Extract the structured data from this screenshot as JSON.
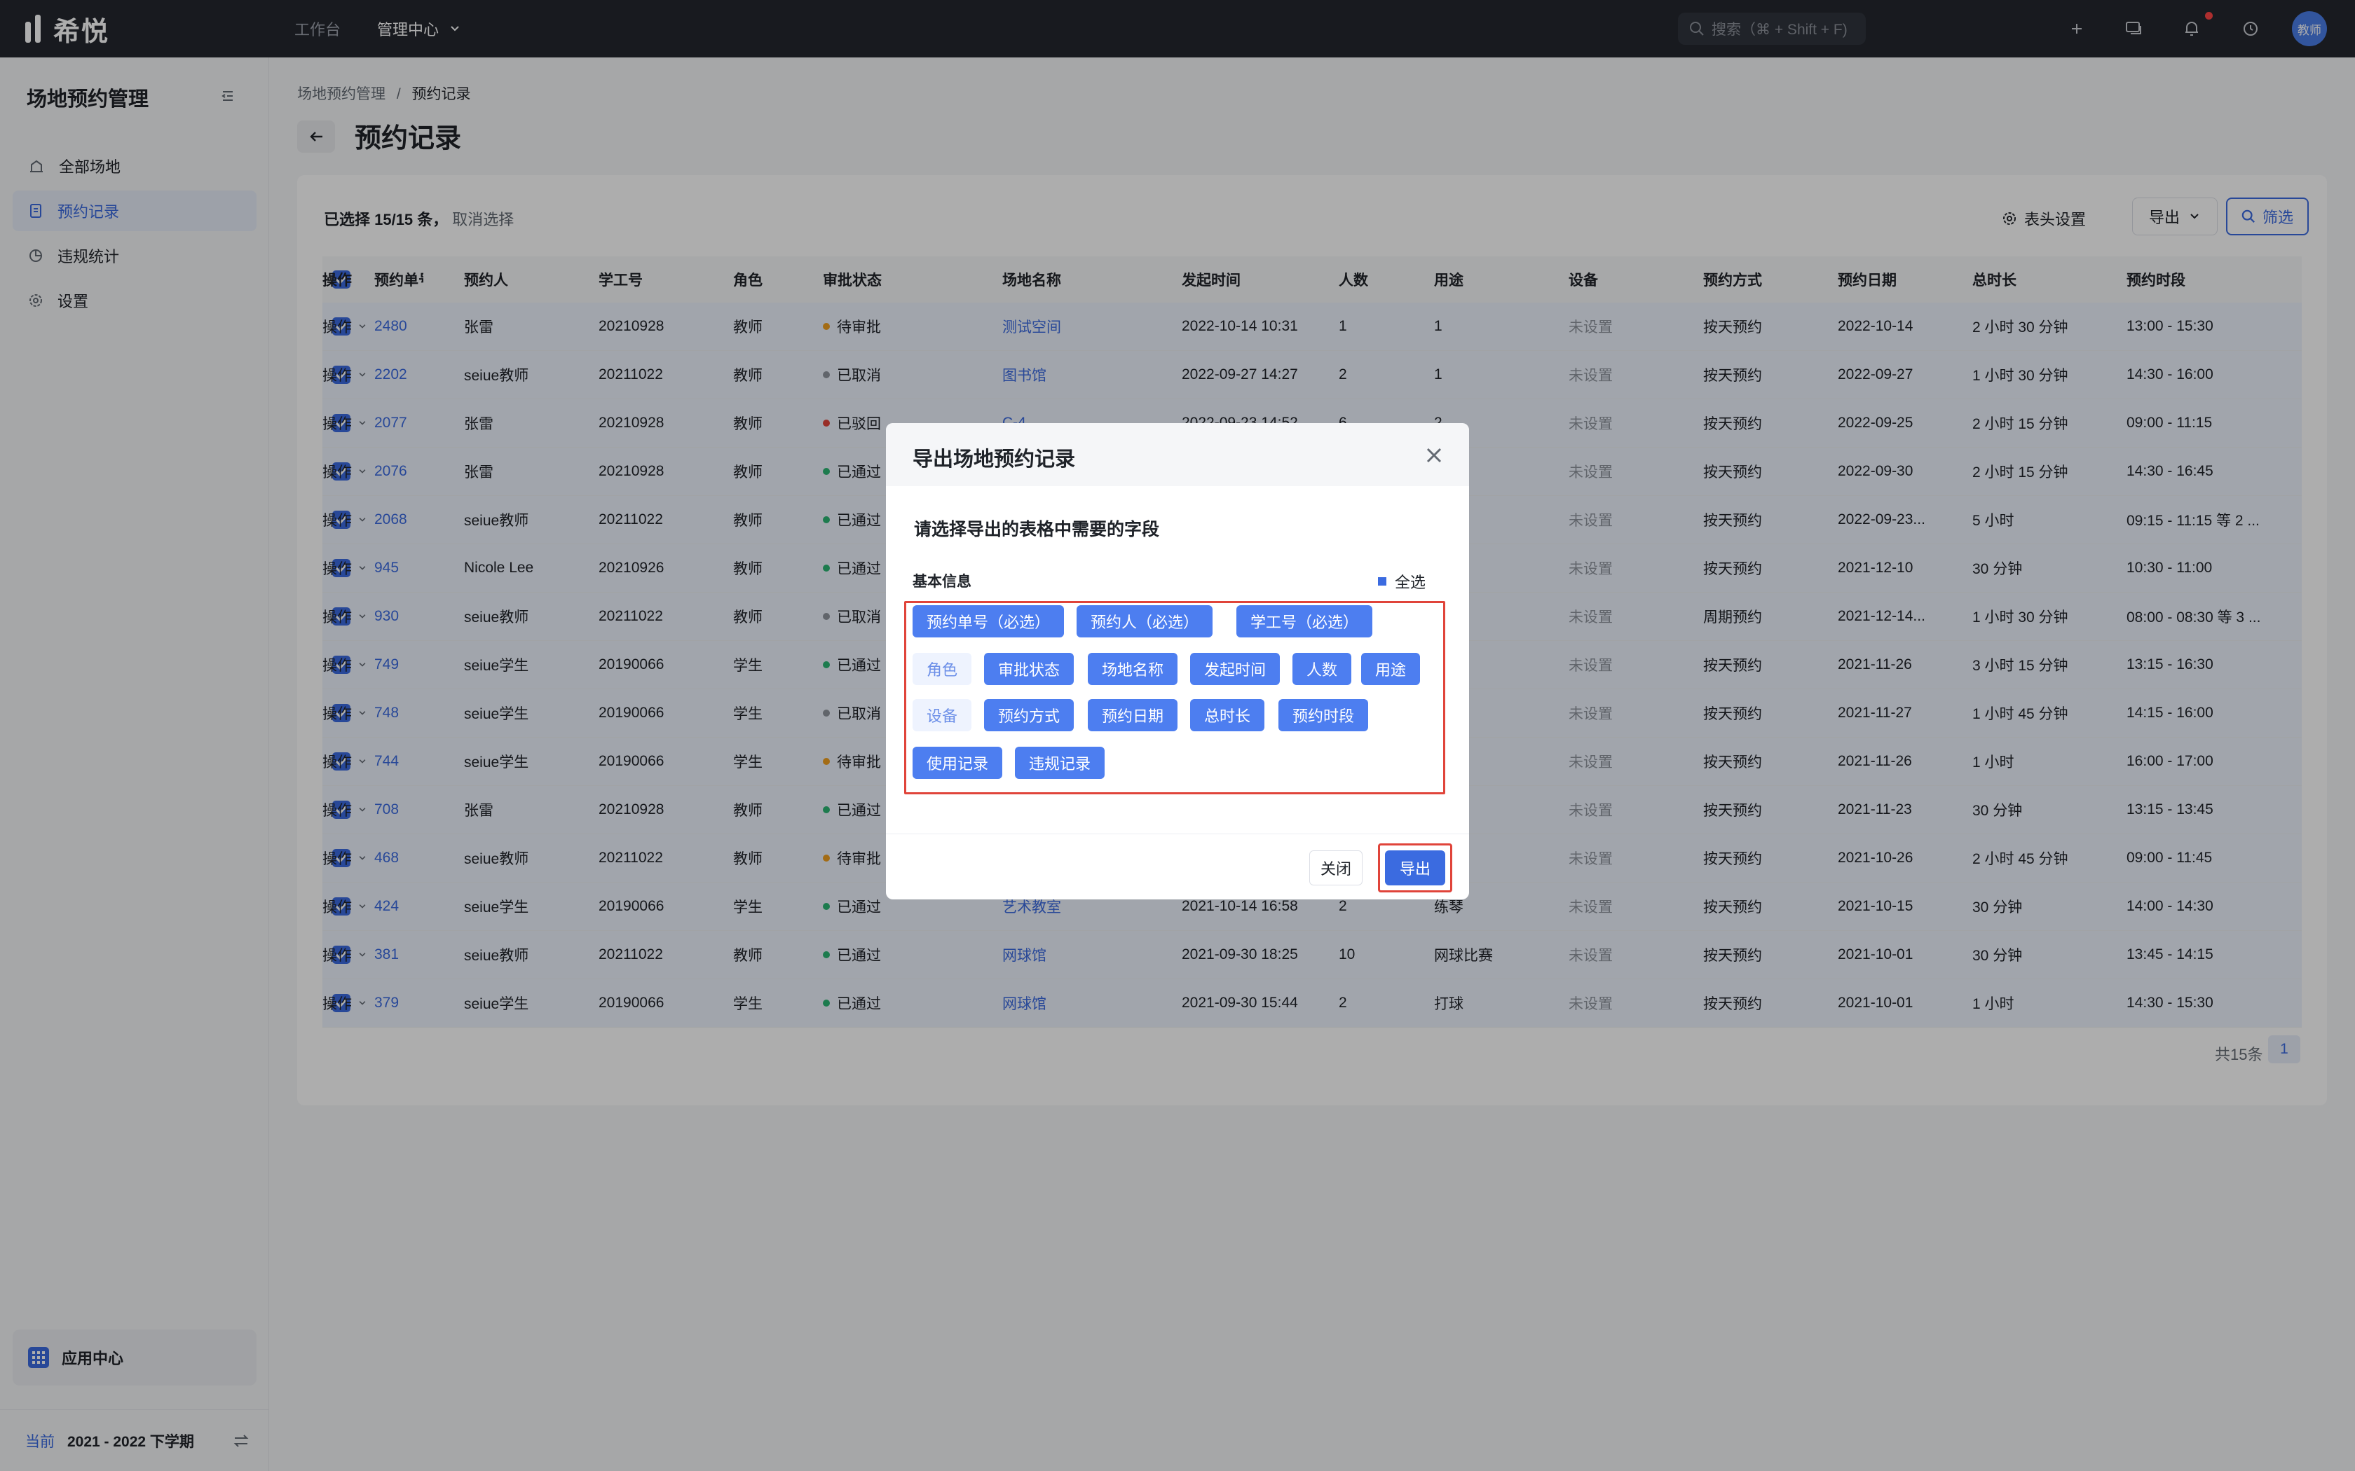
{
  "app": {
    "name": "希悦"
  },
  "topnav": {
    "workbench": "工作台",
    "admin": "管理中心"
  },
  "search": {
    "placeholder": "搜索（⌘ + Shift + F)"
  },
  "user": {
    "avatar_text": "教师"
  },
  "sidebar": {
    "title": "场地预约管理",
    "items": [
      {
        "label": "全部场地",
        "icon": "venue-icon"
      },
      {
        "label": "预约记录",
        "icon": "document-icon",
        "active": true
      },
      {
        "label": "违规统计",
        "icon": "pie-chart-icon"
      },
      {
        "label": "设置",
        "icon": "gear-icon"
      }
    ],
    "app_center": "应用中心",
    "term_tag": "当前",
    "term": "2021 - 2022 下学期"
  },
  "breadcrumb": {
    "root": "场地预约管理",
    "sep": "/",
    "current": "预约记录"
  },
  "page": {
    "title": "预约记录"
  },
  "toolbar": {
    "selection": "已选择 15/15 条，",
    "cancel_selection": "取消选择",
    "header_settings": "表头设置",
    "export": "导出",
    "filter": "筛选"
  },
  "table": {
    "columns": [
      "预约单号",
      "预约人",
      "学工号",
      "角色",
      "审批状态",
      "场地名称",
      "发起时间",
      "人数",
      "用途",
      "设备",
      "预约方式",
      "预约日期",
      "总时长",
      "预约时段",
      "操作"
    ],
    "rows": [
      {
        "id": "2480",
        "person": "张雷",
        "num": "20210928",
        "role": "教师",
        "status": "待审批",
        "status_color": "#f0a020",
        "venue": "测试空间",
        "time": "2022-10-14 10:31",
        "count": "1",
        "use": "1",
        "device": "未设置",
        "mode": "按天预约",
        "date": "2022-10-14",
        "dur": "2 小时 30 分钟",
        "slot": "13:00 - 15:30",
        "op": "操作"
      },
      {
        "id": "2202",
        "person": "seiue教师",
        "num": "20211022",
        "role": "教师",
        "status": "已取消",
        "status_color": "#8f959e",
        "venue": "图书馆",
        "time": "2022-09-27 14:27",
        "count": "2",
        "use": "1",
        "device": "未设置",
        "mode": "按天预约",
        "date": "2022-09-27",
        "dur": "1 小时 30 分钟",
        "slot": "14:30 - 16:00",
        "op": "操作"
      },
      {
        "id": "2077",
        "person": "张雷",
        "num": "20210928",
        "role": "教师",
        "status": "已驳回",
        "status_color": "#e0443a",
        "venue": "C-4",
        "time": "2022-09-23 14:52",
        "count": "6",
        "use": "2",
        "device": "未设置",
        "mode": "按天预约",
        "date": "2022-09-25",
        "dur": "2 小时 15 分钟",
        "slot": "09:00 - 11:15",
        "op": "操作"
      },
      {
        "id": "2076",
        "person": "张雷",
        "num": "20210928",
        "role": "教师",
        "status": "已通过",
        "status_color": "#2bb673",
        "venue": "",
        "time": "",
        "count": "",
        "use": "",
        "device": "未设置",
        "mode": "按天预约",
        "date": "2022-09-30",
        "dur": "2 小时 15 分钟",
        "slot": "14:30 - 16:45",
        "op": "操作"
      },
      {
        "id": "2068",
        "person": "seiue教师",
        "num": "20211022",
        "role": "教师",
        "status": "已通过",
        "status_color": "#2bb673",
        "venue": "",
        "time": "",
        "count": "",
        "use": "",
        "device": "未设置",
        "mode": "按天预约",
        "date": "2022-09-23...",
        "dur": "5 小时",
        "slot": "09:15 - 11:15 等 2 ...",
        "op": "操作"
      },
      {
        "id": "945",
        "person": "Nicole Lee",
        "num": "20210926",
        "role": "教师",
        "status": "已通过",
        "status_color": "#2bb673",
        "venue": "",
        "time": "",
        "count": "",
        "use": "",
        "device": "未设置",
        "mode": "按天预约",
        "date": "2021-12-10",
        "dur": "30 分钟",
        "slot": "10:30 - 11:00",
        "op": "操作"
      },
      {
        "id": "930",
        "person": "seiue教师",
        "num": "20211022",
        "role": "教师",
        "status": "已取消",
        "status_color": "#8f959e",
        "venue": "",
        "time": "",
        "count": "",
        "use": "",
        "device": "未设置",
        "mode": "周期预约",
        "date": "2021-12-14...",
        "dur": "1 小时 30 分钟",
        "slot": "08:00 - 08:30 等 3 ...",
        "op": "操作"
      },
      {
        "id": "749",
        "person": "seiue学生",
        "num": "20190066",
        "role": "学生",
        "status": "已通过",
        "status_color": "#2bb673",
        "venue": "",
        "time": "",
        "count": "",
        "use": "",
        "device": "未设置",
        "mode": "按天预约",
        "date": "2021-11-26",
        "dur": "3 小时 15 分钟",
        "slot": "13:15 - 16:30",
        "op": "操作"
      },
      {
        "id": "748",
        "person": "seiue学生",
        "num": "20190066",
        "role": "学生",
        "status": "已取消",
        "status_color": "#8f959e",
        "venue": "",
        "time": "",
        "count": "",
        "use": "",
        "device": "未设置",
        "mode": "按天预约",
        "date": "2021-11-27",
        "dur": "1 小时 45 分钟",
        "slot": "14:15 - 16:00",
        "op": "操作"
      },
      {
        "id": "744",
        "person": "seiue学生",
        "num": "20190066",
        "role": "学生",
        "status": "待审批",
        "status_color": "#f0a020",
        "venue": "",
        "time": "",
        "count": "",
        "use": "",
        "device": "未设置",
        "mode": "按天预约",
        "date": "2021-11-26",
        "dur": "1 小时",
        "slot": "16:00 - 17:00",
        "op": "操作"
      },
      {
        "id": "708",
        "person": "张雷",
        "num": "20210928",
        "role": "教师",
        "status": "已通过",
        "status_color": "#2bb673",
        "venue": "",
        "time": "",
        "count": "",
        "use": "",
        "device": "未设置",
        "mode": "按天预约",
        "date": "2021-11-23",
        "dur": "30 分钟",
        "slot": "13:15 - 13:45",
        "op": "操作"
      },
      {
        "id": "468",
        "person": "seiue教师",
        "num": "20211022",
        "role": "教师",
        "status": "待审批",
        "status_color": "#f0a020",
        "venue": "",
        "time": "",
        "count": "",
        "use": "",
        "device": "未设置",
        "mode": "按天预约",
        "date": "2021-10-26",
        "dur": "2 小时 45 分钟",
        "slot": "09:00 - 11:45",
        "op": "操作"
      },
      {
        "id": "424",
        "person": "seiue学生",
        "num": "20190066",
        "role": "学生",
        "status": "已通过",
        "status_color": "#2bb673",
        "venue": "艺术教室",
        "time": "2021-10-14 16:58",
        "count": "2",
        "use": "练琴",
        "device": "未设置",
        "mode": "按天预约",
        "date": "2021-10-15",
        "dur": "30 分钟",
        "slot": "14:00 - 14:30",
        "op": "操作"
      },
      {
        "id": "381",
        "person": "seiue教师",
        "num": "20211022",
        "role": "教师",
        "status": "已通过",
        "status_color": "#2bb673",
        "venue": "网球馆",
        "time": "2021-09-30 18:25",
        "count": "10",
        "use": "网球比赛",
        "device": "未设置",
        "mode": "按天预约",
        "date": "2021-10-01",
        "dur": "30 分钟",
        "slot": "13:45 - 14:15",
        "op": "操作"
      },
      {
        "id": "379",
        "person": "seiue学生",
        "num": "20190066",
        "role": "学生",
        "status": "已通过",
        "status_color": "#2bb673",
        "venue": "网球馆",
        "time": "2021-09-30 15:44",
        "count": "2",
        "use": "打球",
        "device": "未设置",
        "mode": "按天预约",
        "date": "2021-10-01",
        "dur": "1 小时",
        "slot": "14:30 - 15:30",
        "op": "操作"
      }
    ]
  },
  "pagination": {
    "total": "共15条",
    "page": "1"
  },
  "modal": {
    "title": "导出场地预约记录",
    "subtitle": "请选择导出的表格中需要的字段",
    "group": "基本信息",
    "select_all": "全选",
    "fields": [
      {
        "label": "预约单号（必选）",
        "selected": true
      },
      {
        "label": "预约人（必选）",
        "selected": true
      },
      {
        "label": "学工号（必选）",
        "selected": true
      },
      {
        "label": "角色",
        "selected": false
      },
      {
        "label": "审批状态",
        "selected": true
      },
      {
        "label": "场地名称",
        "selected": true
      },
      {
        "label": "发起时间",
        "selected": true
      },
      {
        "label": "人数",
        "selected": true
      },
      {
        "label": "用途",
        "selected": true
      },
      {
        "label": "设备",
        "selected": false
      },
      {
        "label": "预约方式",
        "selected": true
      },
      {
        "label": "预约日期",
        "selected": true
      },
      {
        "label": "总时长",
        "selected": true
      },
      {
        "label": "预约时段",
        "selected": true
      },
      {
        "label": "使用记录",
        "selected": true
      },
      {
        "label": "违规记录",
        "selected": true
      }
    ],
    "close": "关闭",
    "export": "导出"
  },
  "colors": {
    "accent": "#3b6be0",
    "highlight": "#e0443a",
    "topbar": "#24272f"
  }
}
